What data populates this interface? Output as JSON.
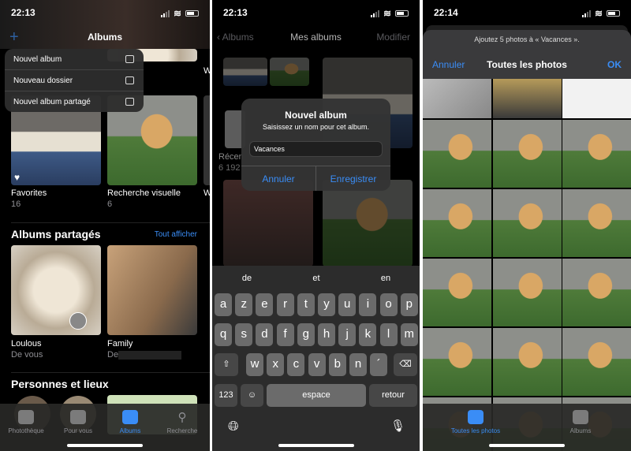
{
  "screen1": {
    "status": {
      "time": "22:13"
    },
    "nav": {
      "add_icon": "plus-icon",
      "title": "Albums"
    },
    "menu": [
      {
        "label": "Nouvel album",
        "icon": "album-add-icon"
      },
      {
        "label": "Nouveau dossier",
        "icon": "folder-add-icon"
      },
      {
        "label": "Nouvel album partagé",
        "icon": "shared-album-add-icon"
      }
    ],
    "albums": [
      {
        "name": "Favorites",
        "count": "16"
      },
      {
        "name": "Recherche visuelle",
        "count": "6"
      }
    ],
    "partial_album_letter": "W",
    "shared": {
      "title": "Albums partagés",
      "see_all": "Tout afficher",
      "items": [
        {
          "name": "Loulous",
          "owner": "De vous"
        },
        {
          "name": "Family",
          "owner": "De"
        }
      ]
    },
    "people": {
      "title": "Personnes et lieux"
    },
    "tabs": [
      {
        "label": "Photothèque",
        "icon": "photos-icon"
      },
      {
        "label": "Pour vous",
        "icon": "for-you-icon"
      },
      {
        "label": "Albums",
        "icon": "albums-icon",
        "active": true
      },
      {
        "label": "Recherche",
        "icon": "search-icon"
      }
    ]
  },
  "screen2": {
    "status": {
      "time": "22:13"
    },
    "nav": {
      "back": "Albums",
      "title": "Mes albums",
      "edit": "Modifier"
    },
    "background": {
      "album_name": "Récen",
      "album_count": "6 192"
    },
    "dialog": {
      "title": "Nouvel album",
      "message": "Saisissez un nom pour cet album.",
      "input_value": "Vacances",
      "cancel": "Annuler",
      "save": "Enregistrer"
    },
    "keyboard": {
      "suggestions": [
        "de",
        "et",
        "en"
      ],
      "row1": [
        "a",
        "z",
        "e",
        "r",
        "t",
        "y",
        "u",
        "i",
        "o",
        "p"
      ],
      "row2": [
        "q",
        "s",
        "d",
        "f",
        "g",
        "h",
        "j",
        "k",
        "l",
        "m"
      ],
      "row3": [
        "w",
        "x",
        "c",
        "v",
        "b",
        "n",
        "´"
      ],
      "numbers": "123",
      "space": "espace",
      "return": "retour"
    }
  },
  "screen3": {
    "status": {
      "time": "22:14"
    },
    "prompt": "Ajoutez 5 photos à « Vacances ».",
    "nav": {
      "cancel": "Annuler",
      "title": "Toutes les photos",
      "ok": "OK"
    },
    "tabs": [
      {
        "label": "Toutes les photos",
        "icon": "all-photos-icon",
        "active": true
      },
      {
        "label": "Albums",
        "icon": "albums-icon"
      }
    ]
  },
  "colors": {
    "accent": "#3a8df6",
    "background": "#000000"
  }
}
